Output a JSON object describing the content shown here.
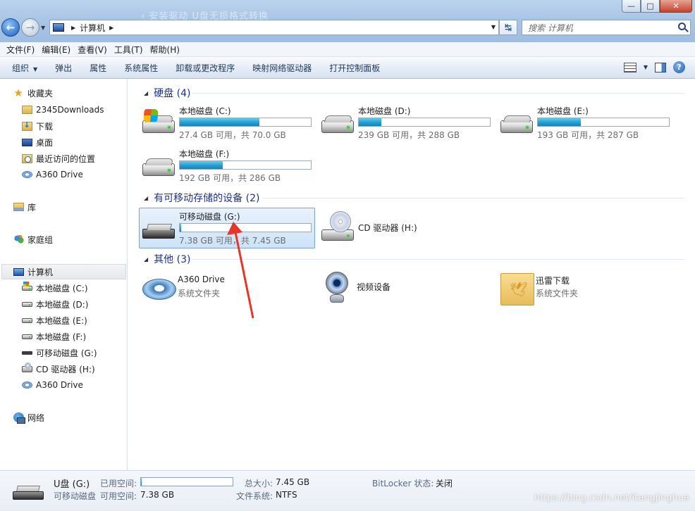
{
  "titlebar": {
    "ghost_text": "‹ 安装驱动    U盘无损格式转换",
    "minimize_glyph": "—",
    "maximize_glyph": "□",
    "close_glyph": "✕"
  },
  "address": {
    "crumb": "计算机",
    "search_placeholder": "搜索 计算机"
  },
  "menu": [
    "文件(F)",
    "编辑(E)",
    "查看(V)",
    "工具(T)",
    "帮助(H)"
  ],
  "commands": [
    "组织",
    "弹出",
    "属性",
    "系统属性",
    "卸载或更改程序",
    "映射网络驱动器",
    "打开控制面板"
  ],
  "sidebar": {
    "favorites": {
      "label": "收藏夹",
      "items": [
        "2345Downloads",
        "下载",
        "桌面",
        "最近访问的位置",
        "A360 Drive"
      ]
    },
    "libraries": "库",
    "homegroup": "家庭组",
    "computer": {
      "label": "计算机",
      "items": [
        "本地磁盘 (C:)",
        "本地磁盘 (D:)",
        "本地磁盘 (E:)",
        "本地磁盘 (F:)",
        "可移动磁盘 (G:)",
        "CD 驱动器 (H:)",
        "A360 Drive"
      ]
    },
    "network": "网络"
  },
  "groups": {
    "hdd": {
      "title": "硬盘 (4)"
    },
    "removable": {
      "title": "有可移动存储的设备 (2)"
    },
    "other": {
      "title": "其他 (3)"
    }
  },
  "drives": [
    {
      "name": "本地磁盘 (C:)",
      "info": "27.4 GB 可用，共 70.0 GB",
      "used_fraction": 0.61
    },
    {
      "name": "本地磁盘 (D:)",
      "info": "239 GB 可用，共 288 GB",
      "used_fraction": 0.17
    },
    {
      "name": "本地磁盘 (E:)",
      "info": "193 GB 可用，共 287 GB",
      "used_fraction": 0.33
    },
    {
      "name": "本地磁盘 (F:)",
      "info": "192 GB 可用，共 286 GB",
      "used_fraction": 0.33
    }
  ],
  "removable": [
    {
      "name": "可移动磁盘 (G:)",
      "info": "7.38 GB 可用，共 7.45 GB",
      "used_fraction": 0.01
    },
    {
      "name": "CD 驱动器 (H:)"
    }
  ],
  "others": [
    {
      "name": "A360 Drive",
      "sub": "系统文件夹"
    },
    {
      "name": "视频设备"
    },
    {
      "name": "迅雷下载",
      "sub": "系统文件夹"
    }
  ],
  "details": {
    "name": "U盘 (G:)",
    "type": "可移动磁盘",
    "used_label": "已用空间:",
    "used_fraction": 0.01,
    "free_label": "可用空间:",
    "free_value": "7.38 GB",
    "total_label": "总大小:",
    "total_value": "7.45 GB",
    "fs_label": "文件系统:",
    "fs_value": "NTFS",
    "bitlocker_label": "BitLocker 状态:",
    "bitlocker_value": "关闭"
  },
  "watermark": "https://blog.csdn.net/itangjinghua",
  "colors": {
    "accent": "#26a0da",
    "group_header": "#1e3287",
    "annotation_arrow": "#e8352a"
  }
}
